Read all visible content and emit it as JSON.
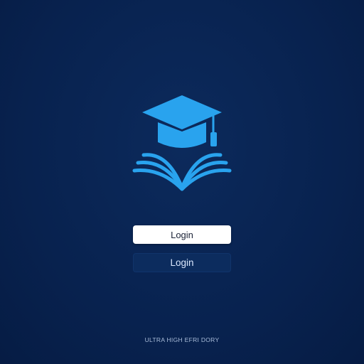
{
  "app": {
    "logo_icon": "graduation-cap-book-icon",
    "accent_color": "#29a3ee",
    "background_color": "#08224f"
  },
  "login": {
    "primary_button_label": "Login",
    "secondary_button_label": "Login"
  },
  "footer": {
    "text": "ULTRA HIGH EFRI DORY"
  }
}
